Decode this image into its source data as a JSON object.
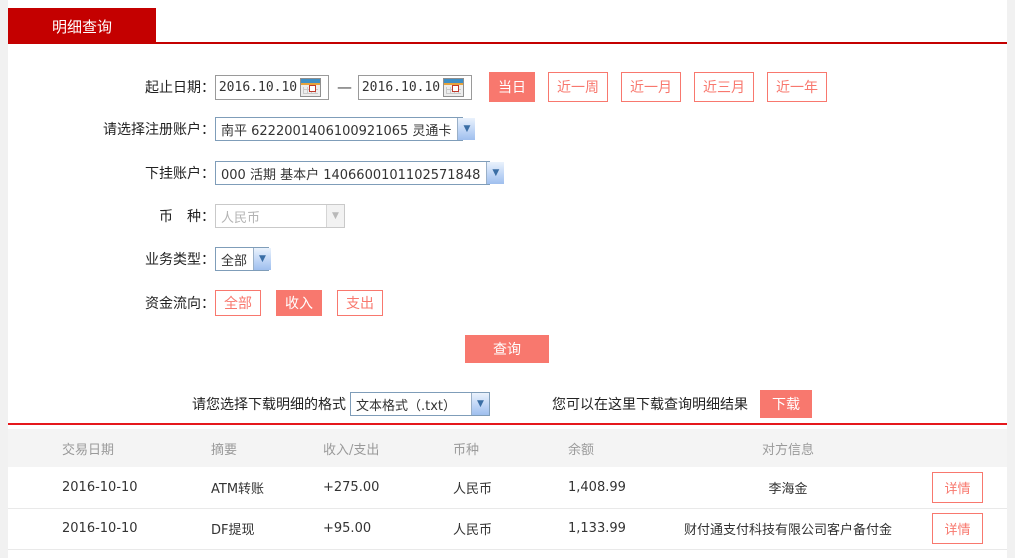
{
  "tab": {
    "label": "明细查询"
  },
  "form": {
    "date_label": "起止日期：",
    "date_from": "2016.10.10",
    "date_to": "2016.10.10",
    "date_separator": "—",
    "quick_ranges": [
      {
        "label": "当日",
        "active": true
      },
      {
        "label": "近一周",
        "active": false
      },
      {
        "label": "近一月",
        "active": false
      },
      {
        "label": "近三月",
        "active": false
      },
      {
        "label": "近一年",
        "active": false
      }
    ],
    "register_account": {
      "label": "请选择注册账户：",
      "value": "南平 6222001406100921065 灵通卡"
    },
    "sub_account": {
      "label": "下挂账户：",
      "value": "000 活期 基本户 1406600101102571848"
    },
    "currency": {
      "label": "币　种：",
      "value": "人民币",
      "disabled": true
    },
    "biz_type": {
      "label": "业务类型：",
      "value": "全部"
    },
    "flow": {
      "label": "资金流向：",
      "options": [
        {
          "label": "全部",
          "active": false
        },
        {
          "label": "收入",
          "active": true
        },
        {
          "label": "支出",
          "active": false
        }
      ]
    },
    "query_label": "查询"
  },
  "download": {
    "format_label": "请您选择下载明细的格式",
    "format_value": "文本格式（.txt）",
    "hint": "您可以在这里下载查询明细结果",
    "button_label": "下载"
  },
  "table": {
    "headers": [
      "交易日期",
      "摘要",
      "收入/支出",
      "币种",
      "余额",
      "对方信息"
    ],
    "rows": [
      {
        "date": "2016-10-10",
        "summary": "ATM转账",
        "amount": "+275.00",
        "currency": "人民币",
        "balance": "1,408.99",
        "counterparty": "李海金",
        "action": "详情"
      },
      {
        "date": "2016-10-10",
        "summary": "DF提现",
        "amount": "+95.00",
        "currency": "人民币",
        "balance": "1,133.99",
        "counterparty": "财付通支付科技有限公司客户备付金",
        "action": "详情"
      }
    ]
  },
  "colors": {
    "tab_red": "#c40000",
    "salmon": "#f8786e",
    "amount_red": "#cc0000",
    "separator_red": "#e5181c",
    "header_text": "#9a9a9a"
  }
}
